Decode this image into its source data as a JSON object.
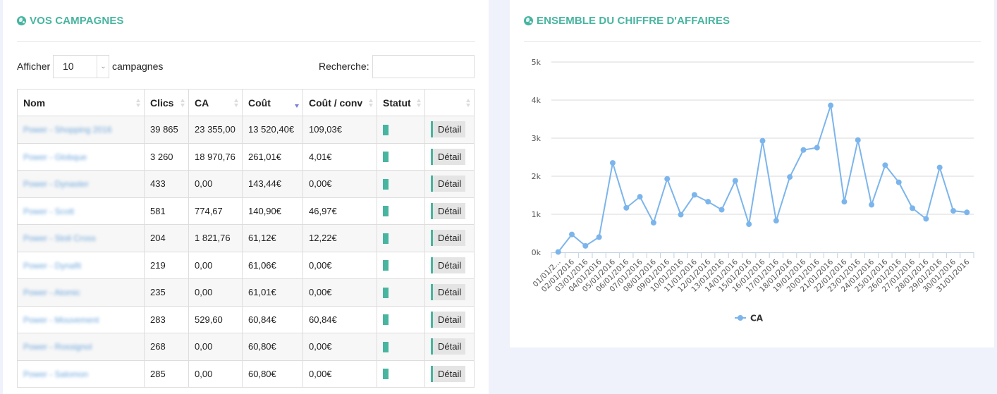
{
  "campaigns_panel": {
    "title": "VOS CAMPAGNES",
    "icon": "globe-icon",
    "length_prefix": "Afficher",
    "length_value": "10",
    "length_suffix": "campagnes",
    "search_label": "Recherche:",
    "search_value": "",
    "columns": [
      {
        "label": "Nom",
        "sort": "none"
      },
      {
        "label": "Clics",
        "sort": "none"
      },
      {
        "label": "CA",
        "sort": "none"
      },
      {
        "label": "Coût",
        "sort": "desc"
      },
      {
        "label": "Coût / conv",
        "sort": "none"
      },
      {
        "label": "Statut",
        "sort": "none"
      },
      {
        "label": "",
        "sort": "none"
      }
    ],
    "detail_label": "Détail",
    "status_color": "#47b5a0",
    "rows": [
      {
        "nom": "Power - Shopping 2016",
        "clics": "39 865",
        "ca": "23 355,00",
        "cout": "13 520,40€",
        "cout_conv": "109,03€",
        "statut": "active"
      },
      {
        "nom": "Power - Globque",
        "clics": "3 260",
        "ca": "18 970,76",
        "cout": "261,01€",
        "cout_conv": "4,01€",
        "statut": "active"
      },
      {
        "nom": "Power - Dynaster",
        "clics": "433",
        "ca": "0,00",
        "cout": "143,44€",
        "cout_conv": "0,00€",
        "statut": "active"
      },
      {
        "nom": "Power - Scott",
        "clics": "581",
        "ca": "774,67",
        "cout": "140,90€",
        "cout_conv": "46,97€",
        "statut": "active"
      },
      {
        "nom": "Power - Stoli Cross",
        "clics": "204",
        "ca": "1 821,76",
        "cout": "61,12€",
        "cout_conv": "12,22€",
        "statut": "active"
      },
      {
        "nom": "Power - Dynafit",
        "clics": "219",
        "ca": "0,00",
        "cout": "61,06€",
        "cout_conv": "0,00€",
        "statut": "active"
      },
      {
        "nom": "Power - Atomic",
        "clics": "235",
        "ca": "0,00",
        "cout": "61,01€",
        "cout_conv": "0,00€",
        "statut": "active"
      },
      {
        "nom": "Power - Mouvement",
        "clics": "283",
        "ca": "529,60",
        "cout": "60,84€",
        "cout_conv": "60,84€",
        "statut": "active"
      },
      {
        "nom": "Power - Rossignol",
        "clics": "268",
        "ca": "0,00",
        "cout": "60,80€",
        "cout_conv": "0,00€",
        "statut": "active"
      },
      {
        "nom": "Power - Salomon",
        "clics": "285",
        "ca": "0,00",
        "cout": "60,80€",
        "cout_conv": "0,00€",
        "statut": "active"
      }
    ]
  },
  "revenue_panel": {
    "title": "ENSEMBLE DU CHIFFRE D'AFFAIRES",
    "icon": "globe-icon"
  },
  "colors": {
    "accent": "#47b5a0",
    "series": "#7cb5ec",
    "sort_active": "#7b7fd6"
  },
  "chart_data": {
    "type": "line",
    "title": "",
    "xlabel": "",
    "ylabel": "",
    "ylim": [
      0,
      5000
    ],
    "yticks": [
      0,
      1000,
      2000,
      3000,
      4000,
      5000
    ],
    "ytick_labels": [
      "0k",
      "1k",
      "2k",
      "3k",
      "4k",
      "5k"
    ],
    "grid": true,
    "legend": "bottom-center",
    "categories": [
      "01/01/2...",
      "02/01/2016",
      "03/01/2016",
      "04/01/2016",
      "05/01/2016",
      "06/01/2016",
      "07/01/2016",
      "08/01/2016",
      "09/01/2016",
      "10/01/2016",
      "11/01/2016",
      "12/01/2016",
      "13/01/2016",
      "14/01/2016",
      "15/01/2016",
      "16/01/2016",
      "17/01/2016",
      "18/01/2016",
      "19/01/2016",
      "20/01/2016",
      "21/01/2016",
      "22/01/2016",
      "23/01/2016",
      "24/01/2016",
      "25/01/2016",
      "26/01/2016",
      "27/01/2016",
      "28/01/2016",
      "29/01/2016",
      "30/01/2016",
      "31/01/2016"
    ],
    "series": [
      {
        "name": "CA",
        "values": [
          10,
          470,
          170,
          400,
          2350,
          1170,
          1460,
          780,
          1930,
          990,
          1510,
          1330,
          1120,
          1880,
          740,
          2930,
          830,
          1980,
          2690,
          2750,
          3860,
          1330,
          2950,
          1250,
          2290,
          1840,
          1160,
          880,
          2230,
          1090,
          1050
        ]
      }
    ]
  }
}
